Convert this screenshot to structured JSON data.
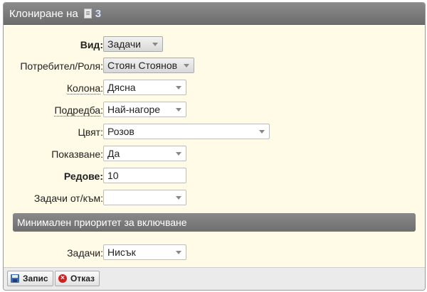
{
  "dialog": {
    "title": "Клониране на",
    "count": "3"
  },
  "form": {
    "vid": {
      "label": "Вид",
      "value": "Задачи"
    },
    "user": {
      "label": "Потребител/Роля",
      "value": "Стоян Стоянов"
    },
    "column": {
      "label": "Колона",
      "value": "Дясна"
    },
    "order": {
      "label": "Подредба",
      "value": "Най-нагоре"
    },
    "color": {
      "label": "Цвят",
      "value": "Розов"
    },
    "show": {
      "label": "Показване",
      "value": "Да"
    },
    "rows": {
      "label": "Редове",
      "value": "10"
    },
    "tasks_from_to": {
      "label": "Задачи от/към",
      "value": ""
    },
    "section_title": "Минимален приоритет за включване",
    "tasks": {
      "label": "Задачи",
      "value": "Нисък"
    }
  },
  "footer": {
    "save_label": "Запис",
    "cancel_label": "Отказ"
  }
}
